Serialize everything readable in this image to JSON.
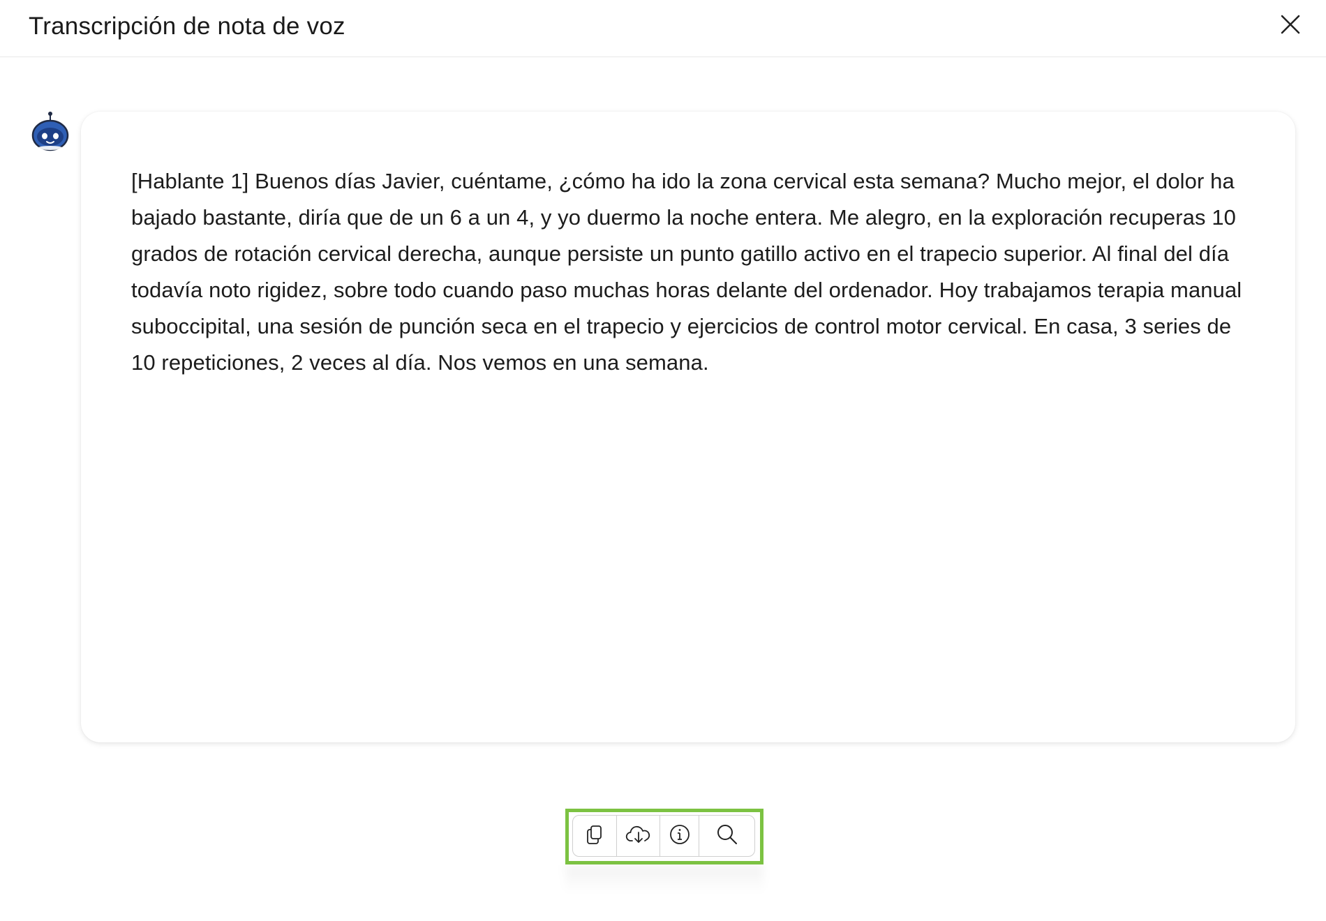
{
  "header": {
    "title": "Transcripción de nota de voz"
  },
  "message": {
    "transcript": "[Hablante 1] Buenos días Javier, cuéntame, ¿cómo ha ido la zona cervical esta semana? Mucho mejor, el dolor ha bajado bastante, diría que de un 6 a un 4, y yo duermo la noche entera. Me alegro, en la exploración recuperas 10 grados de rotación cervical derecha, aunque persiste un punto gatillo activo en el trapecio superior. Al final del día todavía noto rigidez, sobre todo cuando paso muchas horas delante del ordenador. Hoy trabajamos terapia manual suboccipital, una sesión de punción seca en el trapecio y ejercicios de control motor cervical. En casa, 3 series de 10 repeticiones, 2 veces al día. Nos vemos en una semana."
  },
  "icons": {
    "close": "close-icon",
    "avatar": "robot-avatar-icon",
    "copy": "copy-icon",
    "download": "cloud-download-icon",
    "info": "info-icon",
    "search": "search-icon"
  },
  "colors": {
    "highlight": "#7cc242",
    "avatar_blue": "#2f5fb5",
    "text": "#1c1c1c"
  }
}
